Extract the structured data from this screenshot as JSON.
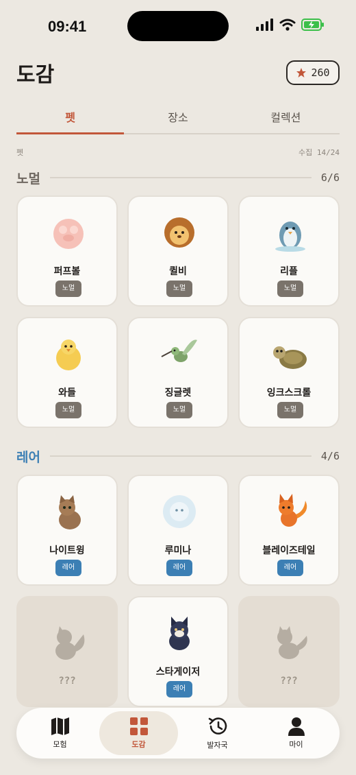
{
  "status_bar": {
    "time": "09:41"
  },
  "header": {
    "title": "도감",
    "points": "260"
  },
  "tabs": [
    {
      "label": "펫",
      "active": true
    },
    {
      "label": "장소",
      "active": false
    },
    {
      "label": "컬렉션",
      "active": false
    }
  ],
  "meta": {
    "category": "펫",
    "collected": "수집 14/24"
  },
  "sections": {
    "normal": {
      "name": "노멀",
      "count": "6/6",
      "color": "#6f6861",
      "pets": [
        {
          "name": "퍼프볼",
          "grade": "노멀"
        },
        {
          "name": "퀼비",
          "grade": "노멀"
        },
        {
          "name": "리플",
          "grade": "노멀"
        },
        {
          "name": "와들",
          "grade": "노멀"
        },
        {
          "name": "징글렛",
          "grade": "노멀"
        },
        {
          "name": "잉크스크롤",
          "grade": "노멀"
        }
      ]
    },
    "rare": {
      "name": "레어",
      "count": "4/6",
      "color": "#3c7fb4",
      "pets": [
        {
          "name": "나이트윙",
          "grade": "레어"
        },
        {
          "name": "루미나",
          "grade": "레어"
        },
        {
          "name": "블레이즈테일",
          "grade": "레어"
        },
        {
          "name": "???",
          "grade": ""
        },
        {
          "name": "스타게이저",
          "grade": "레어"
        },
        {
          "name": "???",
          "grade": ""
        }
      ]
    }
  },
  "bottom_nav": [
    {
      "label": "모험",
      "icon": "map-icon",
      "active": false
    },
    {
      "label": "도감",
      "icon": "grid-icon",
      "active": true
    },
    {
      "label": "발자국",
      "icon": "history-icon",
      "active": false
    },
    {
      "label": "마이",
      "icon": "person-icon",
      "active": false
    }
  ],
  "colors": {
    "accent": "#c2573a",
    "rare": "#3c7fb4",
    "normal_badge": "#7a736b",
    "background": "#ece8e1"
  }
}
